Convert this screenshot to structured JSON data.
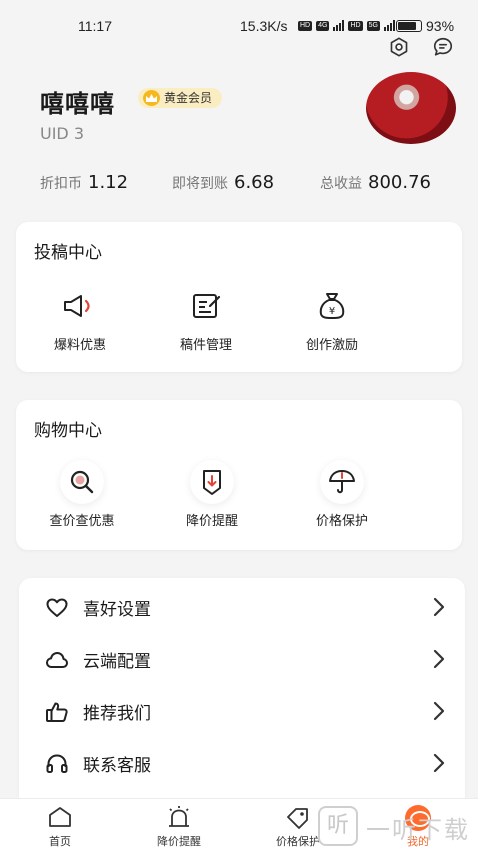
{
  "status": {
    "time": "11:17",
    "network": "15.3K/s",
    "tag1": "HD",
    "tag2": "4G",
    "tag3": "HD",
    "tag4": "5G",
    "battery": "93%"
  },
  "profile": {
    "name": "嘻嘻嘻",
    "badge": "黄金会员",
    "uid": "UID 3"
  },
  "stats": [
    {
      "label": "折扣币",
      "value": "1.12"
    },
    {
      "label": "即将到账",
      "value": "6.68"
    },
    {
      "label": "总收益",
      "value": "800.76"
    }
  ],
  "submission": {
    "title": "投稿中心",
    "items": [
      {
        "label": "爆料优惠",
        "icon": "megaphone-icon"
      },
      {
        "label": "稿件管理",
        "icon": "edit-document-icon"
      },
      {
        "label": "创作激励",
        "icon": "money-bag-icon"
      }
    ]
  },
  "shopping": {
    "title": "购物中心",
    "items": [
      {
        "label": "查价查优惠",
        "icon": "search-icon"
      },
      {
        "label": "降价提醒",
        "icon": "price-drop-icon"
      },
      {
        "label": "价格保护",
        "icon": "umbrella-icon"
      }
    ]
  },
  "menu": [
    {
      "label": "喜好设置",
      "icon": "heart-icon"
    },
    {
      "label": "云端配置",
      "icon": "cloud-icon"
    },
    {
      "label": "推荐我们",
      "icon": "thumbs-up-icon"
    },
    {
      "label": "联系客服",
      "icon": "headset-icon"
    }
  ],
  "tabs": [
    {
      "label": "首页",
      "icon": "home-icon"
    },
    {
      "label": "降价提醒",
      "icon": "alarm-icon"
    },
    {
      "label": "价格保护",
      "icon": "tag-icon"
    },
    {
      "label": "我的",
      "icon": "profile-icon"
    }
  ],
  "watermark": {
    "logo": "听",
    "text": "一听下载"
  },
  "colors": {
    "accent": "#ef6a2c",
    "gold": "#f5b91f",
    "badge_bg": "#fbedc2",
    "danger": "#e0443a"
  }
}
